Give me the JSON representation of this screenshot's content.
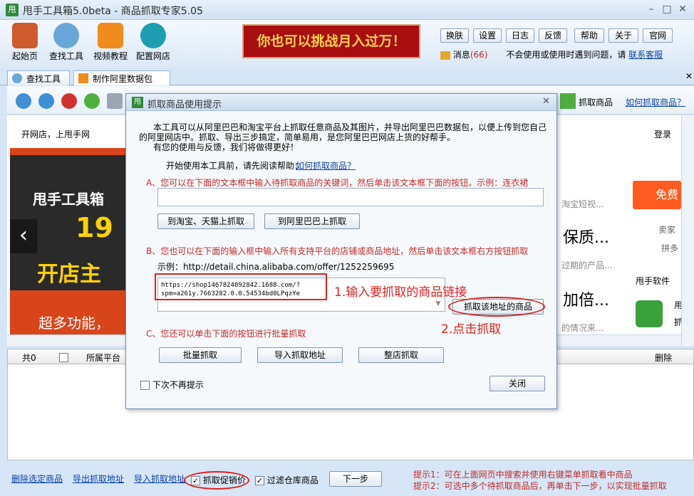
{
  "window": {
    "title": "甩手工具箱5.0beta - 商品抓取专家5.05",
    "app_icon": "甩"
  },
  "toolbar": {
    "tools": [
      {
        "label": "起始页",
        "icon": "house-icon"
      },
      {
        "label": "查找工具",
        "icon": "magnifier-icon"
      },
      {
        "label": "视频教程",
        "icon": "play-icon"
      },
      {
        "label": "配置网店",
        "icon": "gear-icon"
      }
    ],
    "banner": "你也可以挑战月入过万！",
    "buttons": [
      "换肤",
      "设置",
      "日志",
      "反馈",
      "帮助",
      "关于",
      "官网"
    ],
    "message_label": "消息",
    "message_count": "(66)",
    "help_text": "不会使用或使用时遇到问题，请",
    "contact_link": "联系客服"
  },
  "tabs": [
    {
      "label": "查找工具"
    },
    {
      "label": "制作阿里数据包"
    }
  ],
  "nav": {
    "grab_label": "抓取商品",
    "howto_link": "如何抓取商品？"
  },
  "page": {
    "top_left": "开网店，上甩手网",
    "login": "登录",
    "banner_title": "甩手工具箱",
    "banner_num": "19",
    "banner_sub": "开店主",
    "banner_bottom": "超多功能，",
    "right_texts": [
      "淘宝短视...",
      "保质...",
      "过期的产品...",
      "加倍...",
      "的情况来..."
    ],
    "free_btn": "免费",
    "seller_label": "卖家",
    "pinduo": "拼多",
    "software_label": "甩手软件",
    "software_side": [
      "用",
      "抓"
    ]
  },
  "grid": {
    "count_label": "共0",
    "col_platform": "所属平台",
    "col_delete": "删除"
  },
  "bottom": {
    "delete_link": "删除选定商品",
    "export_link": "导出抓取地址",
    "import_link": "导入抓取地址",
    "promo_label": "抓取促销价",
    "filter_label": "过滤仓库商品",
    "next_btn": "下一步",
    "tip1": "提示1：可在上面网页中搜索并使用右键菜单抓取看中商品",
    "tip2": "提示2：可选中多个待抓取商品后，再单击下一步，以实现批量抓取"
  },
  "dialog": {
    "title": "抓取商品使用提示",
    "intro_line1": "本工具可以从阿里巴巴和淘宝平台上抓取任意商品及其图片，并导出阿里巴巴数据包，以便上传到您自己",
    "intro_line2": "的阿里网店中。抓取、导出三步搞定，简单易用，是您阿里巴巴网店上货的好帮手。",
    "intro_line3": "有您的使用与反馈，我们将做得更好！",
    "read_help": "开始使用本工具前，请先阅读帮助：",
    "read_help_link": "如何抓取商品？",
    "section_a": "A、您可以在下面的文本框中输入待抓取商品的关键词，然后单击该文本框下面的按钮。示例：连衣裙",
    "keyword_value": "",
    "btn_taobao": "到淘宝、天猫上抓取",
    "btn_alibaba": "到阿里巴巴上抓取",
    "section_b": "B、您也可以在下面的输入框中输入所有支持平台的店铺或商品地址，然后单击该文本框右方按钮抓取",
    "example": "示例：http://detail.china.alibaba.com/offer/1252259695",
    "url_line1": "https://shop1467824892842.1688.com/?",
    "url_line2": "spm=a261y.7663282.0.0.54534bd0LPqzYe",
    "btn_grab_url": "抓取该地址的商品",
    "section_c": "C、您还可以单击下面的按钮进行批量抓取",
    "btn_batch": "批量抓取",
    "btn_import": "导入抓取地址",
    "btn_shop": "整店抓取",
    "no_show_label": "下次不再提示",
    "btn_close": "关闭"
  },
  "annotations": {
    "step1": "1.输入要抓取的商品链接",
    "step2": "2.点击抓取"
  },
  "colors": {
    "accent_red": "#e1201f",
    "link_blue": "#0b3fa8",
    "banner_red": "#a80d10"
  }
}
